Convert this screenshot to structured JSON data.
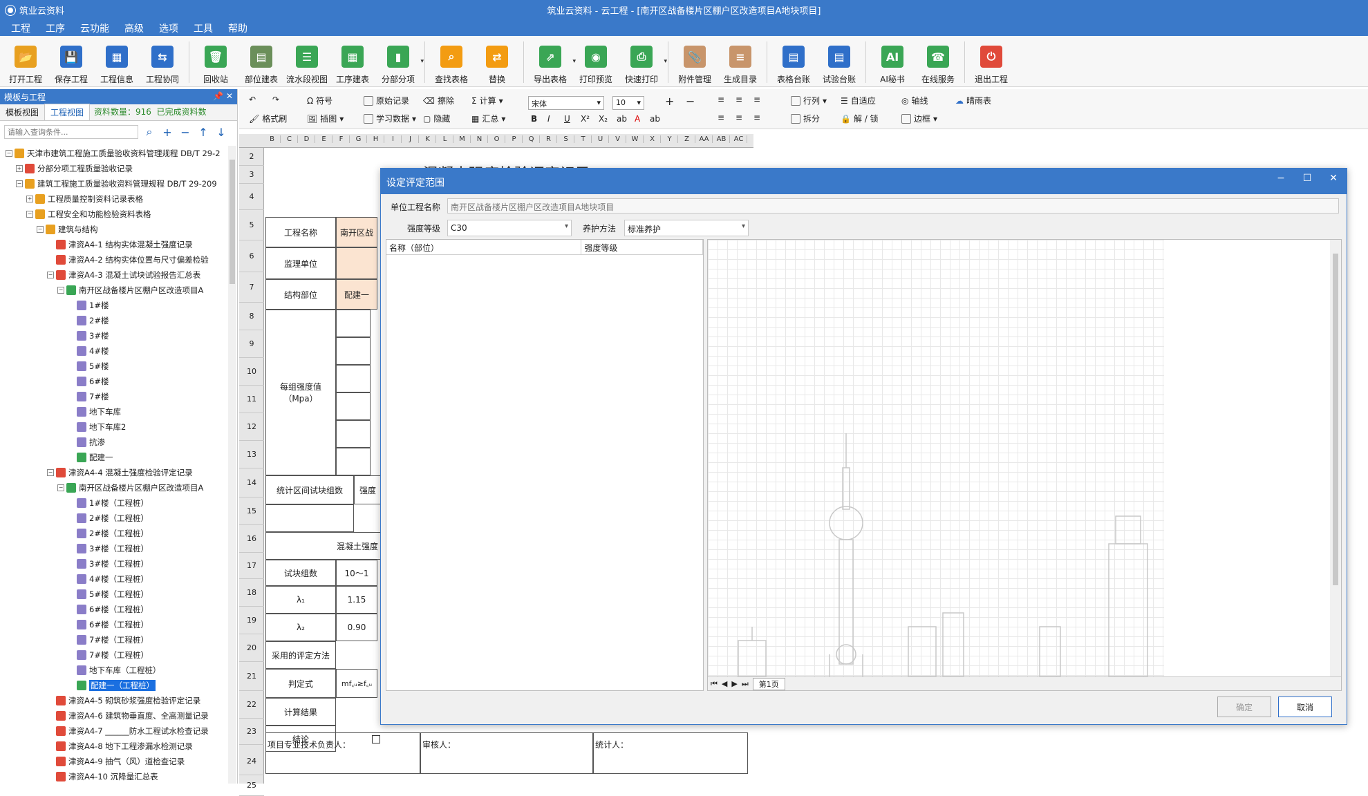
{
  "title": {
    "app": "筑业云资料",
    "window": "筑业云资料 -  云工程 - [南开区战备楼片区棚户区改造项目A地块项目]"
  },
  "menu": [
    "工程",
    "工序",
    "云功能",
    "高级",
    "选项",
    "工具",
    "帮助"
  ],
  "toolbar": [
    {
      "label": "打开工程",
      "icon": "open-folder-icon",
      "color": "#e8a020",
      "glyph": "📂"
    },
    {
      "label": "保存工程",
      "icon": "save-icon",
      "color": "#2f6fc9",
      "glyph": "💾"
    },
    {
      "label": "工程信息",
      "icon": "building-icon",
      "color": "#2f6fc9",
      "glyph": "▦"
    },
    {
      "label": "工程协同",
      "icon": "handshake-icon",
      "color": "#2f6fc9",
      "glyph": "⇆"
    },
    {
      "label": "回收站",
      "icon": "recycle-bin-icon",
      "color": "#3aa655",
      "glyph": "🗑"
    },
    {
      "label": "部位建表",
      "icon": "table-build-icon",
      "color": "#6b8f5a",
      "glyph": "▤"
    },
    {
      "label": "流水段视图",
      "icon": "list-view-icon",
      "color": "#3aa655",
      "glyph": "☰"
    },
    {
      "label": "工序建表",
      "icon": "process-table-icon",
      "color": "#3aa655",
      "glyph": "▦"
    },
    {
      "label": "分部分项",
      "icon": "bar-chart-icon",
      "color": "#3aa655",
      "glyph": "▮",
      "dropdown": true
    },
    {
      "label": "查找表格",
      "icon": "search-icon",
      "color": "#f39c12",
      "glyph": "⌕"
    },
    {
      "label": "替换",
      "icon": "replace-icon",
      "color": "#f39c12",
      "glyph": "⇄"
    },
    {
      "label": "导出表格",
      "icon": "export-icon",
      "color": "#3aa655",
      "glyph": "⇗",
      "dropdown": true
    },
    {
      "label": "打印预览",
      "icon": "preview-eye-icon",
      "color": "#3aa655",
      "glyph": "◉"
    },
    {
      "label": "快速打印",
      "icon": "printer-icon",
      "color": "#3aa655",
      "glyph": "⎙",
      "dropdown": true
    },
    {
      "label": "附件管理",
      "icon": "attachment-icon",
      "color": "#c8956b",
      "glyph": "📎"
    },
    {
      "label": "生成目录",
      "icon": "catalog-icon",
      "color": "#c8956b",
      "glyph": "≡"
    },
    {
      "label": "表格台账",
      "icon": "ledger-icon",
      "color": "#2f6fc9",
      "glyph": "▤"
    },
    {
      "label": "试验台账",
      "icon": "test-ledger-icon",
      "color": "#2f6fc9",
      "glyph": "▤"
    },
    {
      "label": "AI秘书",
      "icon": "ai-icon",
      "color": "#3aa655",
      "glyph": "AI"
    },
    {
      "label": "在线服务",
      "icon": "support-icon",
      "color": "#3aa655",
      "glyph": "☎"
    },
    {
      "label": "退出工程",
      "icon": "power-icon",
      "color": "#e04a3a",
      "glyph": "⏻"
    }
  ],
  "panel": {
    "title": "模板与工程",
    "tabs": [
      "模板视图",
      "工程视图"
    ],
    "count": "资料数量：916",
    "done": "已完成资料数",
    "search_placeholder": "请输入查询条件..."
  },
  "tree": [
    {
      "level": 0,
      "label": "天津市建筑工程施工质量验收资料管理规程 DB/T 29-2",
      "icon": "#e8a020",
      "toggle": "−"
    },
    {
      "level": 1,
      "label": "分部分项工程质量验收记录",
      "icon": "#e04a3a",
      "toggle": "+"
    },
    {
      "level": 1,
      "label": "建筑工程施工质量验收资料管理规程 DB/T 29-209",
      "icon": "#e8a020",
      "toggle": "−"
    },
    {
      "level": 2,
      "label": "工程质量控制资料记录表格",
      "icon": "#e8a020",
      "toggle": "+"
    },
    {
      "level": 2,
      "label": "工程安全和功能检验资料表格",
      "icon": "#e8a020",
      "toggle": "−"
    },
    {
      "level": 3,
      "label": "建筑与结构",
      "icon": "#e8a020",
      "toggle": "−"
    },
    {
      "level": 4,
      "label": "津资A4-1 结构实体混凝土强度记录",
      "icon": "#e04a3a"
    },
    {
      "level": 4,
      "label": "津资A4-2 结构实体位置与尺寸偏差检验",
      "icon": "#e04a3a"
    },
    {
      "level": 4,
      "label": "津资A4-3 混凝土试块试验报告汇总表",
      "icon": "#e04a3a",
      "toggle": "−"
    },
    {
      "level": 5,
      "label": "南开区战备楼片区棚户区改造项目A",
      "icon": "#3aa655",
      "toggle": "−"
    },
    {
      "level": 6,
      "label": "1#楼",
      "icon": "#8a7dc8"
    },
    {
      "level": 6,
      "label": "2#楼",
      "icon": "#8a7dc8"
    },
    {
      "level": 6,
      "label": "3#楼",
      "icon": "#8a7dc8"
    },
    {
      "level": 6,
      "label": "4#楼",
      "icon": "#8a7dc8"
    },
    {
      "level": 6,
      "label": "5#楼",
      "icon": "#8a7dc8"
    },
    {
      "level": 6,
      "label": "6#楼",
      "icon": "#8a7dc8"
    },
    {
      "level": 6,
      "label": "7#楼",
      "icon": "#8a7dc8"
    },
    {
      "level": 6,
      "label": "地下车库",
      "icon": "#8a7dc8"
    },
    {
      "level": 6,
      "label": "地下车库2",
      "icon": "#8a7dc8"
    },
    {
      "level": 6,
      "label": "抗渗",
      "icon": "#8a7dc8"
    },
    {
      "level": 6,
      "label": "配建一",
      "icon": "#3aa655"
    },
    {
      "level": 4,
      "label": "津资A4-4 混凝土强度检验评定记录",
      "icon": "#e04a3a",
      "toggle": "−"
    },
    {
      "level": 5,
      "label": "南开区战备楼片区棚户区改造项目A",
      "icon": "#3aa655",
      "toggle": "−"
    },
    {
      "level": 6,
      "label": "1#楼（工程桩）",
      "icon": "#8a7dc8"
    },
    {
      "level": 6,
      "label": "2#楼（工程桩）",
      "icon": "#8a7dc8"
    },
    {
      "level": 6,
      "label": "2#楼（工程桩）",
      "icon": "#8a7dc8"
    },
    {
      "level": 6,
      "label": "3#楼（工程桩）",
      "icon": "#8a7dc8"
    },
    {
      "level": 6,
      "label": "3#楼（工程桩）",
      "icon": "#8a7dc8"
    },
    {
      "level": 6,
      "label": "4#楼（工程桩）",
      "icon": "#8a7dc8"
    },
    {
      "level": 6,
      "label": "5#楼（工程桩）",
      "icon": "#8a7dc8"
    },
    {
      "level": 6,
      "label": "6#楼（工程桩）",
      "icon": "#8a7dc8"
    },
    {
      "level": 6,
      "label": "6#楼（工程桩）",
      "icon": "#8a7dc8"
    },
    {
      "level": 6,
      "label": "7#楼（工程桩）",
      "icon": "#8a7dc8"
    },
    {
      "level": 6,
      "label": "7#楼（工程桩）",
      "icon": "#8a7dc8"
    },
    {
      "level": 6,
      "label": "地下车库（工程桩）",
      "icon": "#8a7dc8"
    },
    {
      "level": 6,
      "label": "配建一（工程桩）",
      "icon": "#3aa655",
      "selected": true
    },
    {
      "level": 4,
      "label": "津资A4-5 砌筑砂浆强度检验评定记录",
      "icon": "#e04a3a"
    },
    {
      "level": 4,
      "label": "津资A4-6 建筑物垂直度、全高测量记录",
      "icon": "#e04a3a"
    },
    {
      "level": 4,
      "label": "津资A4-7 ______防水工程试水检查记录",
      "icon": "#e04a3a"
    },
    {
      "level": 4,
      "label": "津资A4-8 地下工程渗漏水检测记录",
      "icon": "#e04a3a"
    },
    {
      "level": 4,
      "label": "津资A4-9 抽气（风）道检查记录",
      "icon": "#e04a3a"
    },
    {
      "level": 4,
      "label": "津资A4-10 沉降量汇总表",
      "icon": "#e04a3a"
    }
  ],
  "format": {
    "symbol": "符号",
    "formatbrush": "格式刷",
    "insert": "插图",
    "original": "原始记录",
    "learn": "学习数据",
    "erase": "擦除",
    "hide": "隐藏",
    "calc": "计算",
    "summary": "汇总",
    "font": "宋体",
    "size": "10",
    "rowcol": "行列",
    "split": "拆分",
    "autofit": "自适应",
    "lock": "解 / 锁",
    "axis": "轴线",
    "border": "边框",
    "weather": "晴雨表"
  },
  "columns": [
    "B",
    "C",
    "D",
    "E",
    "F",
    "G",
    "H",
    "I",
    "J",
    "K",
    "L",
    "M",
    "N",
    "O",
    "P",
    "Q",
    "R",
    "S",
    "T",
    "U",
    "V",
    "W",
    "X",
    "Y",
    "Z",
    "AA",
    "AB",
    "AC"
  ],
  "rows": [
    "2",
    "3",
    "4",
    "5",
    "6",
    "7",
    "8",
    "9",
    "10",
    "11",
    "12",
    "13",
    "14",
    "15",
    "16",
    "17",
    "18",
    "19",
    "20",
    "21",
    "22",
    "23",
    "24",
    "25"
  ],
  "sheet": {
    "title": "混凝土强度检验评定记录",
    "project_label": "工程名称",
    "project_value": "南开区战",
    "supervisor_label": "监理单位",
    "part_label": "结构部位",
    "part_value": "配建一",
    "strength_label": "每组强度值\n（Mpa）",
    "stat_label": "统计区间试块组数",
    "strength_short": "强度",
    "concrete_strength": "混凝土强度",
    "group_label": "试块组数",
    "group_value": "10～1",
    "lambda1": "λ₁",
    "lambda1_value": "1.15",
    "lambda2": "λ₂",
    "lambda2_value": "0.90",
    "method_label": "采用的评定方法",
    "formula_label": "判定式",
    "formula_value": "mf꜀ᵤ≥f꜀ᵤ",
    "result_label": "计算结果",
    "conclusion_label": "结论",
    "tech_lead": "项目专业技术负责人：",
    "reviewer": "审核人：",
    "statistician": "统计人："
  },
  "dialog": {
    "title": "设定评定范围",
    "unit_label": "单位工程名称",
    "unit_value": "南开区战备楼片区棚户区改造项目A地块项目",
    "grade_label": "强度等级",
    "grade_value": "C30",
    "cure_label": "养护方法",
    "cure_value": "标准养护",
    "col_name": "名称（部位）",
    "col_grade": "强度等级",
    "sheet_tab": "第1页",
    "ok": "确定",
    "cancel": "取消"
  }
}
